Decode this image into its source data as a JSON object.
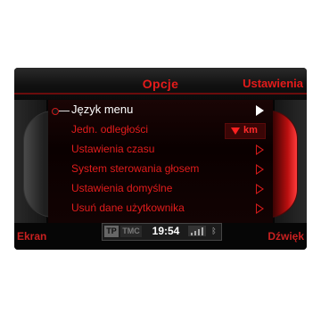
{
  "header": {
    "title": "Opcje",
    "right_label": "Ustawienia"
  },
  "menu": {
    "items": [
      {
        "label": "Język menu",
        "active": true,
        "arrow": "filled"
      },
      {
        "label": "Jedn. odległości",
        "value": "km"
      },
      {
        "label": "Ustawienia czasu",
        "arrow": "outline"
      },
      {
        "label": "System sterowania głosem",
        "arrow": "outline"
      },
      {
        "label": "Ustawienia domyślne",
        "arrow": "outline"
      },
      {
        "label": "Usuń dane użytkownika",
        "arrow": "outline"
      }
    ]
  },
  "footer": {
    "left_label": "Ekran",
    "right_label": "Dźwięk"
  },
  "status": {
    "tp": "TP",
    "tmc": "TMC",
    "time": "19:54"
  },
  "colors": {
    "accent": "#e21c1c",
    "background": "#050505",
    "active_text": "#ffffff"
  },
  "icons": {
    "selection_marker": "selection-dot-icon",
    "submenu_arrow": "chevron-right-icon",
    "unit_dropdown": "triangle-down-icon",
    "signal": "signal-bars-icon",
    "bluetooth": "bluetooth-icon"
  }
}
